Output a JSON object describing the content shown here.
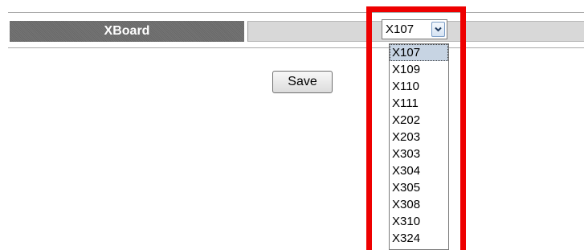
{
  "setting": {
    "label": "XBoard",
    "selected_value": "X107"
  },
  "dropdown": {
    "options": [
      "X107",
      "X109",
      "X110",
      "X111",
      "X202",
      "X203",
      "X303",
      "X304",
      "X305",
      "X308",
      "X310",
      "X324"
    ],
    "highlighted_option": "X107"
  },
  "actions": {
    "save_label": "Save"
  },
  "annotation": {
    "highlight_color": "#ee0000"
  },
  "colors": {
    "label_background": "#6e6e6e",
    "value_background": "#d8d8d8",
    "option_highlight": "#c7d4e3"
  }
}
